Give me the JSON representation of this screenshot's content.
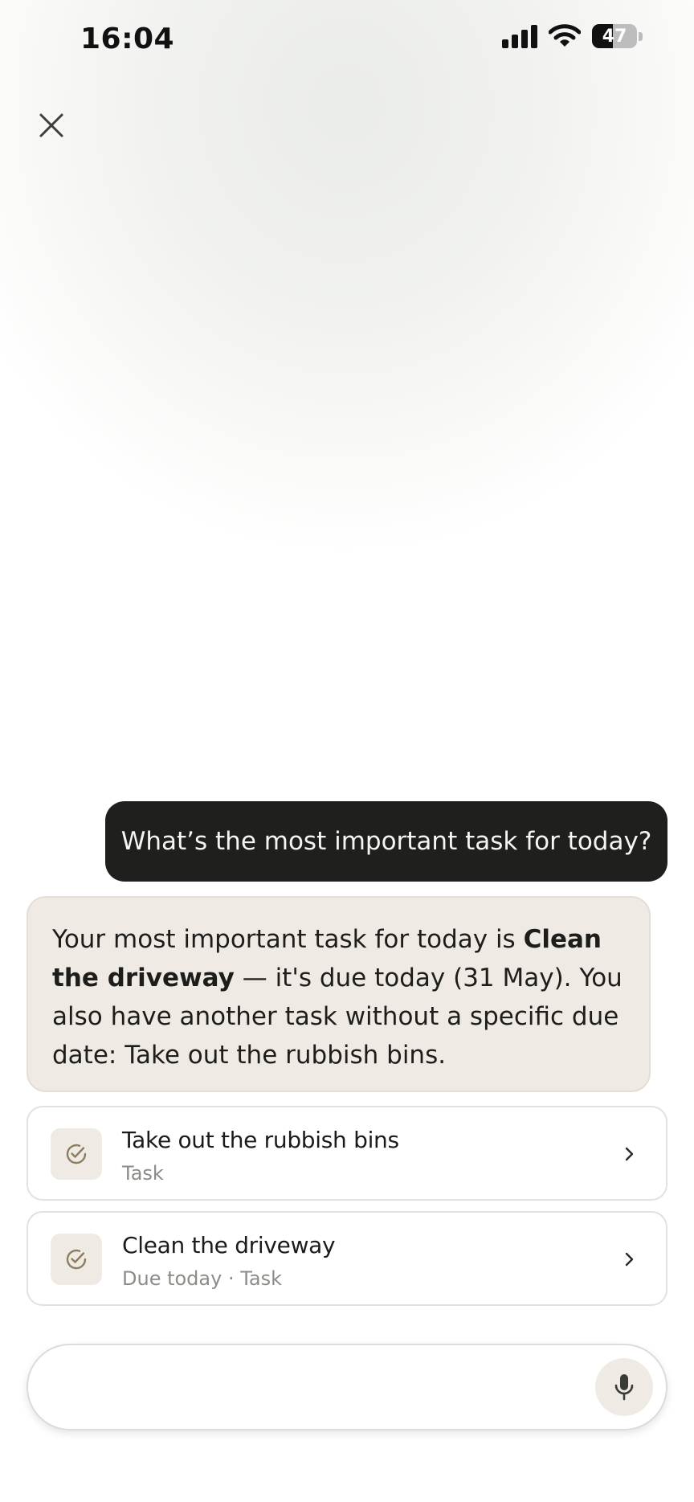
{
  "status_bar": {
    "time": "16:04",
    "battery_level": "47",
    "signal_icon": "cellular-signal-icon",
    "wifi_icon": "wifi-icon"
  },
  "header": {
    "close_icon": "close-icon"
  },
  "conversation": {
    "user_message": "What’s the most important task for today?",
    "assistant_message": {
      "prefix": "Your most important task for today is ",
      "highlight": "Clean the driveway",
      "suffix": " — it's due today (31 May). You also have another task without a specific due date: Take out the rubbish bins."
    }
  },
  "tasks": [
    {
      "title": "Take out the rubbish bins",
      "subtitle": "Task",
      "icon": "check-circle-icon"
    },
    {
      "title": "Clean the driveway",
      "subtitle": "Due today · Task",
      "icon": "check-circle-icon"
    }
  ],
  "composer": {
    "input_value": "",
    "placeholder": "",
    "mic_icon": "microphone-icon"
  },
  "colors": {
    "user_bubble": "#1f201e",
    "assistant_bubble": "#efebe4",
    "icon_accent": "#8c7d5e"
  }
}
